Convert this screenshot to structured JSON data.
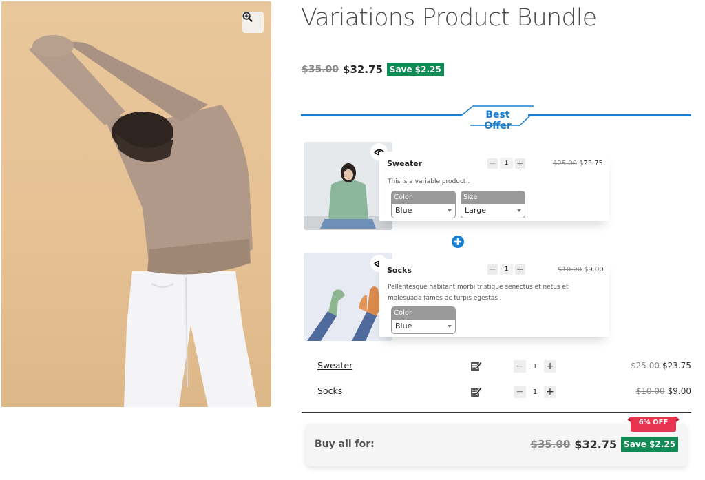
{
  "product": {
    "title": "Variations Product Bundle",
    "price_old": "$35.00",
    "price_new": "$32.75",
    "save_badge": "Save $2.25"
  },
  "offer": {
    "label": "Best Offer",
    "accent_color": "#1a7fd1"
  },
  "bundle_items": [
    {
      "name": "Sweater",
      "quantity": "1",
      "price_old": "$25.00",
      "price_new": "$23.75",
      "description": "This is a variable product .",
      "attributes": [
        {
          "label": "Color",
          "value": "Blue"
        },
        {
          "label": "Size",
          "value": "Large"
        }
      ]
    },
    {
      "name": "Socks",
      "quantity": "1",
      "price_old": "$10.00",
      "price_new": "$9.00",
      "description_line1": "Pellentesque habitant morbi tristique senectus et netus et",
      "description_line2": "malesuada fames ac turpis egestas .",
      "attributes": [
        {
          "label": "Color",
          "value": "Blue"
        }
      ]
    }
  ],
  "summary": [
    {
      "name": "Sweater",
      "quantity": "1",
      "price_old": "$25.00",
      "price_new": "$23.75"
    },
    {
      "name": "Socks",
      "quantity": "1",
      "price_old": "$10.00",
      "price_new": "$9.00"
    }
  ],
  "buy_all": {
    "label": "Buy all for:",
    "price_old": "$35.00",
    "price_new": "$32.75",
    "save_badge": "Save $2.25",
    "discount_ribbon": "6% OFF"
  },
  "controls": {
    "minus": "−",
    "plus": "+"
  },
  "icons": {
    "zoom": "zoom-in-icon",
    "quick_view": "eye-icon",
    "add_separator": "plus-circle-icon",
    "edit": "edit-icon"
  },
  "colors": {
    "save_green": "#118a55",
    "ribbon_red": "#e8344e",
    "accent_blue": "#1a7fd1"
  }
}
